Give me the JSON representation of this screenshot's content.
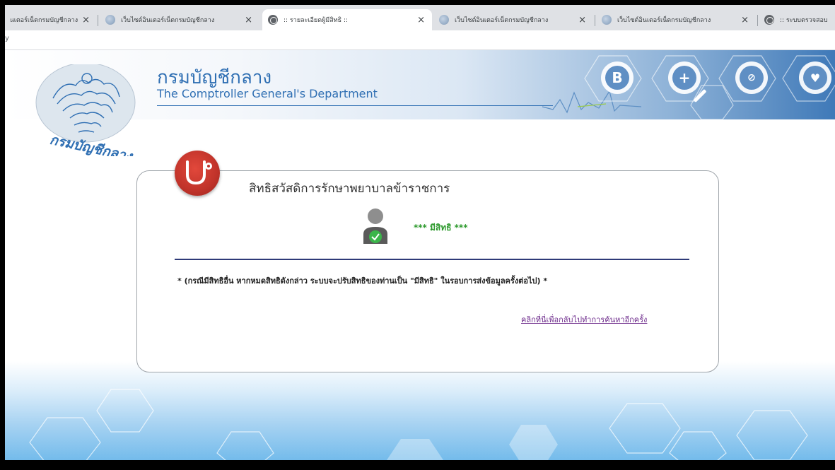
{
  "browser": {
    "tabs": [
      {
        "label": "เว็บไซต์อินเตอร์เน็ตกรมบัญชีกลาง",
        "favicon": "gov-emblem-icon",
        "active": false
      },
      {
        "label": "เว็บไซต์อินเตอร์เน็ตกรมบัญชีกลาง",
        "favicon": "gov-emblem-icon",
        "active": false
      },
      {
        "label": ":: รายละเอียดผู้มีสิทธิ ::",
        "favicon": "globe-icon",
        "active": true
      },
      {
        "label": "เว็บไซต์อินเตอร์เน็ตกรมบัญชีกลาง",
        "favicon": "gov-emblem-icon",
        "active": false
      },
      {
        "label": "เว็บไซต์อินเตอร์เน็ตกรมบัญชีกลาง",
        "favicon": "gov-emblem-icon",
        "active": false
      },
      {
        "label": ":: ระบบตรวจสอบ",
        "favicon": "globe-icon",
        "active": false
      }
    ],
    "close_glyph": "×",
    "toolbar_fragment": "y"
  },
  "header": {
    "title_th": "กรมบัญชีกลาง",
    "title_en": "The Comptroller General's Department",
    "logo_text": "กรมบัญชีกลาง",
    "decor_icons": [
      "bitcoin-icon",
      "medical-cross-icon",
      "pill-icon",
      "heart-pulse-icon"
    ]
  },
  "card": {
    "title": "สิทธิสวัสดิการรักษาพยาบาลข้าราชการ",
    "status": "*** มีสิทธิ ***",
    "notice": "* (กรณีมีสิทธิอื่น หากหมดสิทธิดังกล่าว ระบบจะปรับสิทธิของท่านเป็น \"มีสิทธิ\" ในรอบการส่งข้อมูลครั้งต่อไป) *",
    "back_link": "คลิกที่นี่เพื่อกลับไปทำการค้นหาอีกครั้ง"
  },
  "colors": {
    "brand_blue": "#2f6fb3",
    "status_green": "#2e9a2e",
    "badge_red": "#c0332a",
    "divider_navy": "#2e3a78",
    "link_purple": "#6e2c8c"
  }
}
